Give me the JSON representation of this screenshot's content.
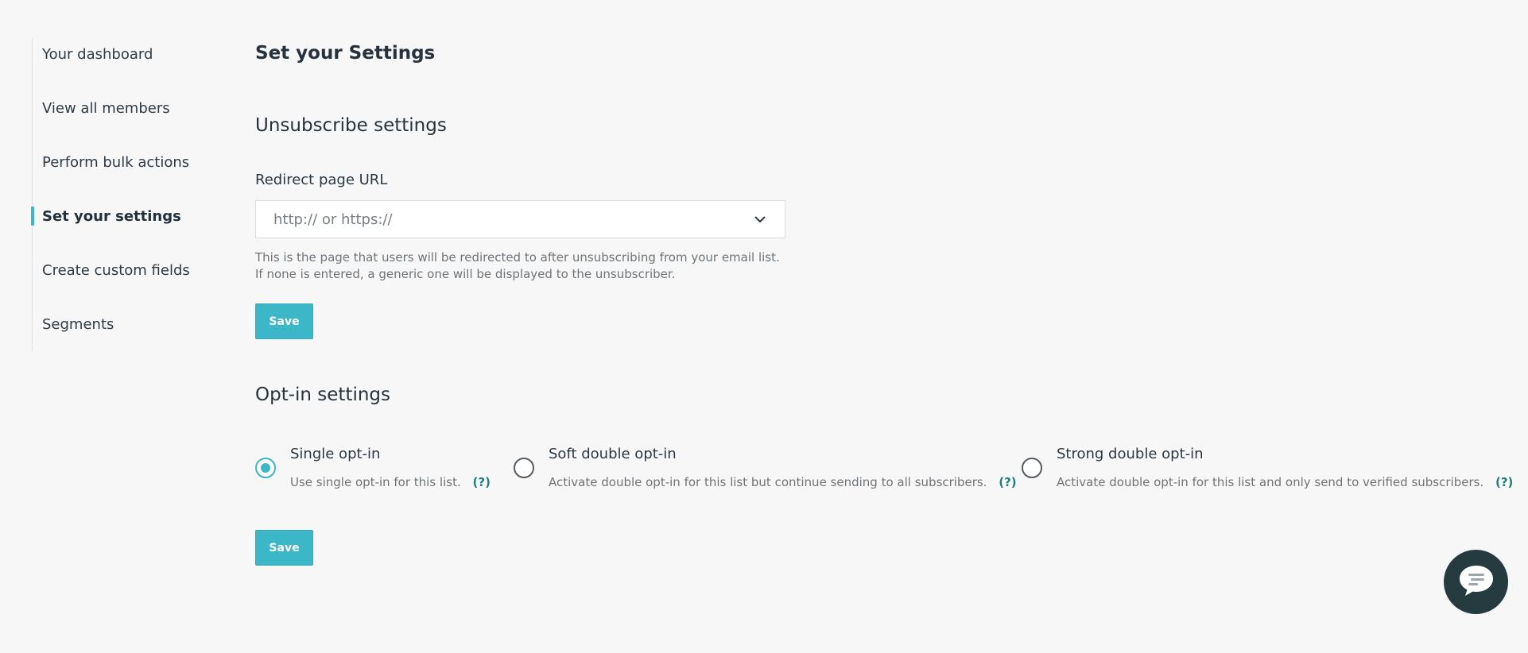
{
  "sidebar": {
    "items": [
      {
        "label": "Your dashboard",
        "active": false
      },
      {
        "label": "View all members",
        "active": false
      },
      {
        "label": "Perform bulk actions",
        "active": false
      },
      {
        "label": "Set your settings",
        "active": true
      },
      {
        "label": "Create custom fields",
        "active": false
      },
      {
        "label": "Segments",
        "active": false
      }
    ]
  },
  "main": {
    "page_title": "Set your Settings",
    "unsubscribe": {
      "title": "Unsubscribe settings",
      "redirect_label": "Redirect page URL",
      "redirect_placeholder": "http:// or https://",
      "redirect_value": "",
      "help_text": "This is the page that users will be redirected to after unsubscribing from your email list. If none is entered, a generic one will be displayed to the unsubscriber.",
      "save_label": "Save"
    },
    "optin": {
      "title": "Opt-in settings",
      "selected": "single",
      "options": [
        {
          "id": "single",
          "title": "Single opt-in",
          "description": "Use single opt-in for this list.",
          "help": "(?)"
        },
        {
          "id": "soft",
          "title": "Soft double opt-in",
          "description": "Activate double opt-in for this list but continue sending to all subscribers.",
          "help": "(?)"
        },
        {
          "id": "strong",
          "title": "Strong double opt-in",
          "description": "Activate double opt-in for this list and only send to verified subscribers.",
          "help": "(?)"
        }
      ],
      "save_label": "Save"
    }
  },
  "icons": {
    "select_chevron": "chevron-down-icon",
    "chat": "chat-icon"
  },
  "colors": {
    "accent": "#3bb7c7",
    "help_link": "#1e7f7a",
    "chat_bg": "#263b3f",
    "background": "#f7f7f7"
  }
}
